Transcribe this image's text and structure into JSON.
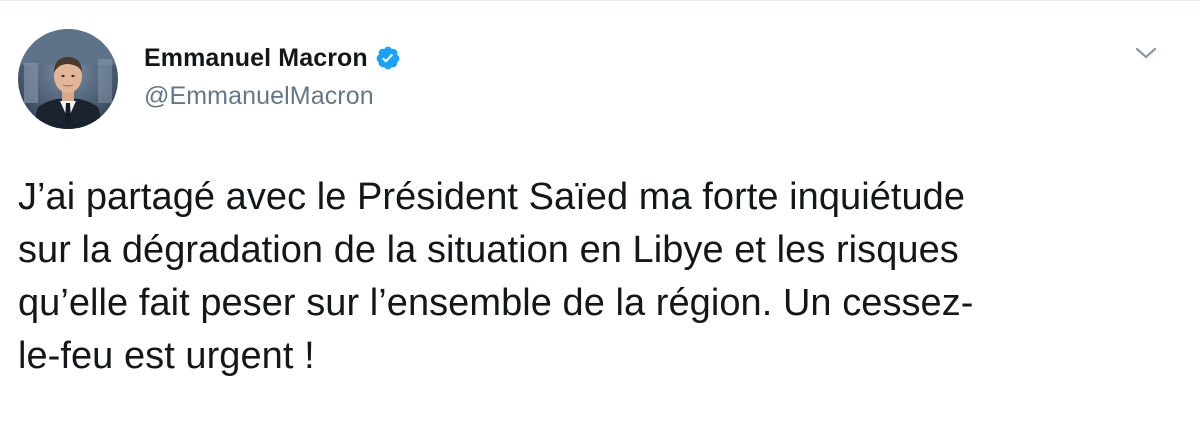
{
  "author": {
    "display_name": "Emmanuel Macron",
    "handle": "@EmmanuelMacron",
    "verified": true,
    "avatar_icon": "profile-photo"
  },
  "tweet": {
    "text": "J’ai partagé avec le Président Saïed ma forte inquiétude\nsur la dégradation de la situation en Libye et les risques\nqu’elle fait peser sur l’ensemble de la région. Un cessez-\nle-feu est urgent !"
  },
  "icons": {
    "verified": "verified-badge-icon",
    "menu": "chevron-down-icon"
  },
  "colors": {
    "accent": "#1da1f2",
    "text": "#14171a",
    "secondary": "#657786"
  }
}
